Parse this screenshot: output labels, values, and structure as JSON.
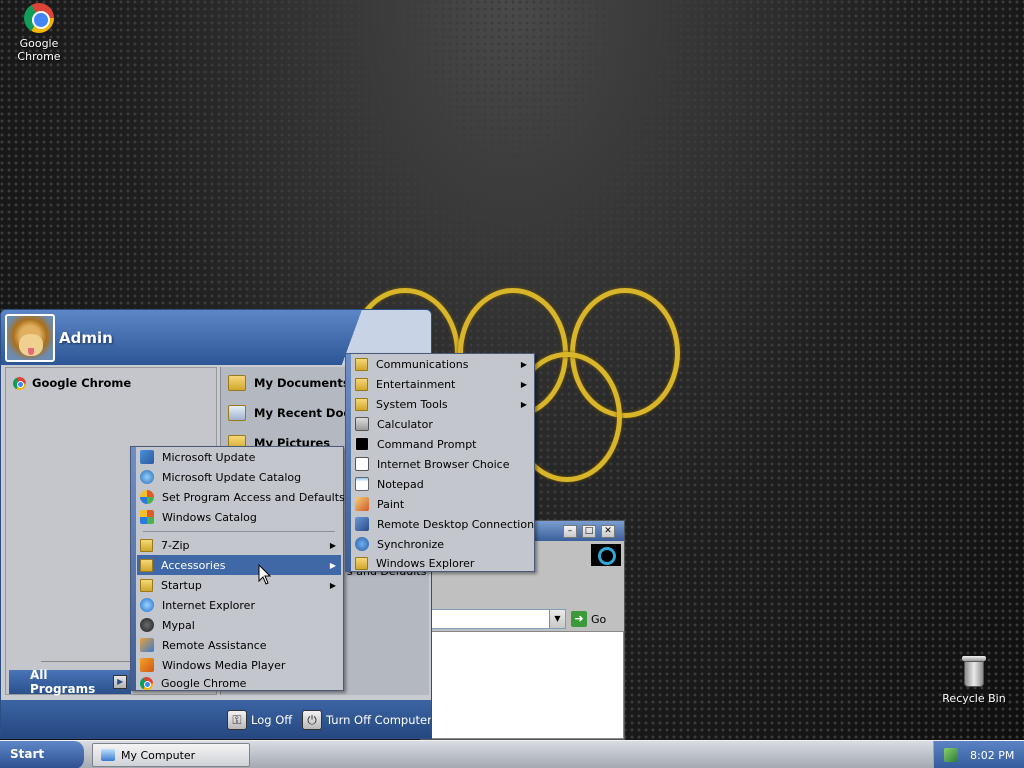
{
  "desktop": {
    "icons": [
      {
        "label": "Google Chrome",
        "icon": "chrome-icon"
      },
      {
        "label": "Recycle Bin",
        "icon": "recycle-bin-icon"
      }
    ]
  },
  "start_menu": {
    "user": "Admin",
    "pinned": [
      {
        "label": "Google Chrome",
        "icon": "chrome-icon"
      }
    ],
    "right_items": [
      {
        "label": "My Documents",
        "icon": "my-documents-icon"
      },
      {
        "label": "My Recent Docu",
        "icon": "my-recent-documents-icon"
      },
      {
        "label": "My Pictures",
        "icon": "my-pictures-icon"
      }
    ],
    "behind_text": "s and Defaults",
    "all_programs": "All Programs",
    "log_off": "Log Off",
    "turn_off": "Turn Off Computer"
  },
  "programs_menu": {
    "top_items": [
      {
        "label": "Microsoft Update",
        "icon": "update-icon"
      },
      {
        "label": "Microsoft Update Catalog",
        "icon": "globe-icon"
      },
      {
        "label": "Set Program Access and Defaults",
        "icon": "program-access-icon"
      },
      {
        "label": "Windows Catalog",
        "icon": "catalog-icon"
      }
    ],
    "items": [
      {
        "label": "7-Zip",
        "icon": "folder-icon",
        "submenu": true
      },
      {
        "label": "Accessories",
        "icon": "folder-icon",
        "submenu": true,
        "highlighted": true
      },
      {
        "label": "Startup",
        "icon": "folder-icon",
        "submenu": true
      },
      {
        "label": "Internet Explorer",
        "icon": "ie-icon"
      },
      {
        "label": "Mypal",
        "icon": "mypal-icon"
      },
      {
        "label": "Remote Assistance",
        "icon": "remote-assistance-icon"
      },
      {
        "label": "Windows Media Player",
        "icon": "media-player-icon"
      },
      {
        "label": "Google Chrome",
        "icon": "chrome-icon"
      }
    ]
  },
  "accessories_menu": {
    "items": [
      {
        "label": "Communications",
        "icon": "folder-icon",
        "submenu": true
      },
      {
        "label": "Entertainment",
        "icon": "folder-icon",
        "submenu": true
      },
      {
        "label": "System Tools",
        "icon": "folder-icon",
        "submenu": true
      },
      {
        "label": "Calculator",
        "icon": "calculator-icon"
      },
      {
        "label": "Command Prompt",
        "icon": "command-prompt-icon"
      },
      {
        "label": "Internet Browser Choice",
        "icon": "browser-choice-icon"
      },
      {
        "label": "Notepad",
        "icon": "notepad-icon"
      },
      {
        "label": "Paint",
        "icon": "paint-icon"
      },
      {
        "label": "Remote Desktop Connection",
        "icon": "remote-desktop-icon"
      },
      {
        "label": "Synchronize",
        "icon": "synchronize-icon"
      },
      {
        "label": "Windows Explorer",
        "icon": "explorer-icon"
      }
    ]
  },
  "background_window": {
    "go_label": "Go"
  },
  "taskbar": {
    "start": "Start",
    "task": "My Computer",
    "time": "8:02 PM"
  },
  "colors": {
    "menu_highlight": "#4068a6",
    "ring_gold": "#d9b52a"
  }
}
